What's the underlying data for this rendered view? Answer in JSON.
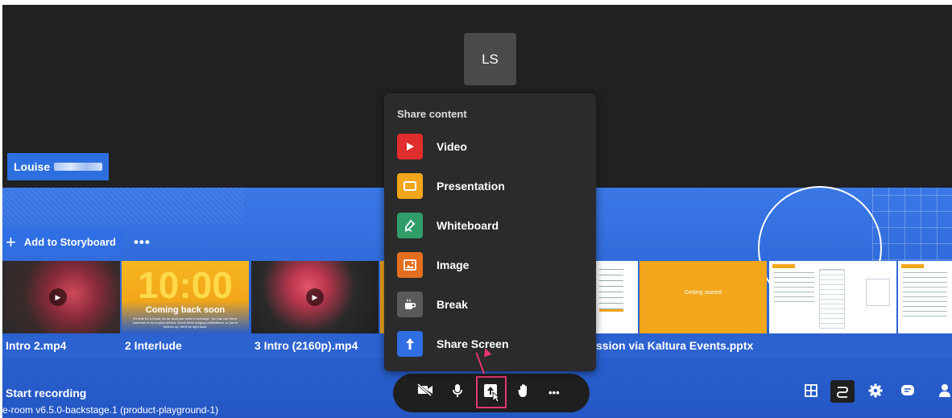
{
  "participant": {
    "initials": "LS",
    "name": "Louise"
  },
  "storyboard": {
    "add_label": "Add to Storyboard",
    "more_label": "•••"
  },
  "media": [
    {
      "label": "Intro 2.mp4"
    },
    {
      "label": "2 Interlude"
    },
    {
      "label": "3 Intro (2160p).mp4"
    },
    {
      "label": "ssion via Kaltura Events.pptx"
    }
  ],
  "interlude_thumb": {
    "time": "10:00",
    "caption": "Coming back soon",
    "small": "It's time for a break, so do what you need to recharge. You can use these moments to do a quick stretch, check those pinging notifications, or just to freshen up. We'll be right back."
  },
  "slide_thumb": {
    "text": "Getting started"
  },
  "share_menu": {
    "title": "Share content",
    "items": [
      {
        "label": "Video",
        "icon": "video-icon",
        "color": "#e02d2d"
      },
      {
        "label": "Presentation",
        "icon": "presentation-icon",
        "color": "#f2a61a"
      },
      {
        "label": "Whiteboard",
        "icon": "whiteboard-icon",
        "color": "#2f9e6a"
      },
      {
        "label": "Image",
        "icon": "image-icon",
        "color": "#e36e1f"
      },
      {
        "label": "Break",
        "icon": "coffee-icon",
        "color": "#5a5a5a"
      },
      {
        "label": "Share Screen",
        "icon": "share-screen-icon",
        "color": "#2f6fe3"
      }
    ]
  },
  "footer": {
    "start_recording": "Start recording",
    "version": "e-room v6.5.0-backstage.1 (product-playground-1)"
  },
  "controls": {
    "more": "•••"
  },
  "colors": {
    "accent": "#2f6fe3",
    "highlight": "#e5386d"
  }
}
